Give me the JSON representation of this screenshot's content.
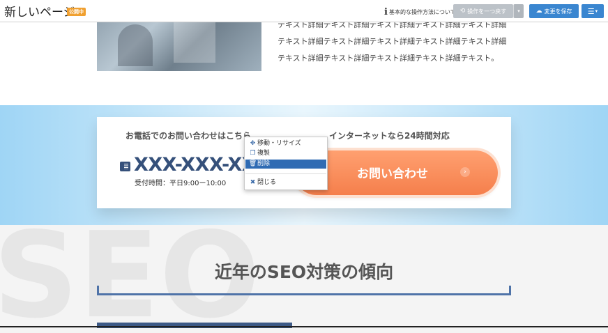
{
  "header": {
    "page_title": "新しいページ",
    "status_badge": "公開中",
    "help_link": "基本的な操作方法について",
    "undo_button": "操作を一つ戻す",
    "save_button": "変更を保存",
    "menu_icon": "hamburger-icon"
  },
  "content": {
    "detail_text": "テキスト詳細テキスト詳細テキスト詳細テキスト詳細テキスト詳細テキスト詳細テキスト詳細テキスト詳細テキスト詳細テキスト詳細テキスト詳細テキスト詳細テキスト詳細テキスト詳細テキスト。",
    "cta": {
      "phone_heading": "お電話でのお問い合わせはこちら",
      "phone_number": "XXX-XXX-XXXX",
      "hours": "受付時間：平日9:00ー10:00",
      "net_heading": "インターネットなら24時間対応",
      "contact_button": "お問い合わせ"
    },
    "seo": {
      "watermark": "SEO",
      "heading": "近年のSEO対策の傾向"
    }
  },
  "context_menu": {
    "items": [
      {
        "label": "移動・リサイズ",
        "icon": "move-icon"
      },
      {
        "label": "複製",
        "icon": "copy-icon"
      },
      {
        "label": "削除",
        "icon": "trash-icon",
        "selected": true
      },
      {
        "label": "閉じる",
        "icon": "close-icon"
      }
    ]
  },
  "colors": {
    "accent_blue": "#3a86d0",
    "badge_orange": "#f0a030",
    "cta_orange": "#f57f4c",
    "phone_navy": "#35507a",
    "menu_selected": "#2f6bb3"
  }
}
